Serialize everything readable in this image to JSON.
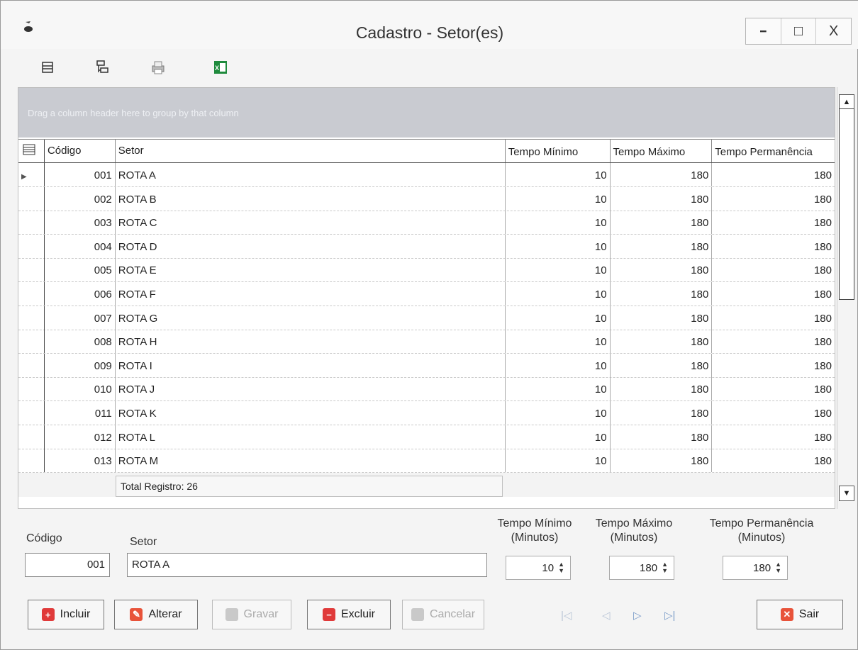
{
  "window": {
    "title": "Cadastro - Setor(es)",
    "controls": {
      "minimize": "━",
      "maximize": "□",
      "close": "X"
    }
  },
  "toolbar": {
    "icons": [
      "grid-view-icon",
      "tree-view-icon",
      "print-icon",
      "excel-export-icon"
    ]
  },
  "grid": {
    "group_panel_text": "Drag a column header here to group by that column",
    "columns": [
      "Código",
      "Setor",
      "Tempo Mínimo",
      "Tempo Máximo",
      "Tempo Permanência"
    ],
    "rows": [
      {
        "codigo": "001",
        "setor": "ROTA A",
        "min": "10",
        "max": "180",
        "perm": "180"
      },
      {
        "codigo": "002",
        "setor": "ROTA B",
        "min": "10",
        "max": "180",
        "perm": "180"
      },
      {
        "codigo": "003",
        "setor": "ROTA C",
        "min": "10",
        "max": "180",
        "perm": "180"
      },
      {
        "codigo": "004",
        "setor": "ROTA D",
        "min": "10",
        "max": "180",
        "perm": "180"
      },
      {
        "codigo": "005",
        "setor": "ROTA E",
        "min": "10",
        "max": "180",
        "perm": "180"
      },
      {
        "codigo": "006",
        "setor": "ROTA F",
        "min": "10",
        "max": "180",
        "perm": "180"
      },
      {
        "codigo": "007",
        "setor": "ROTA G",
        "min": "10",
        "max": "180",
        "perm": "180"
      },
      {
        "codigo": "008",
        "setor": "ROTA H",
        "min": "10",
        "max": "180",
        "perm": "180"
      },
      {
        "codigo": "009",
        "setor": "ROTA I",
        "min": "10",
        "max": "180",
        "perm": "180"
      },
      {
        "codigo": "010",
        "setor": "ROTA J",
        "min": "10",
        "max": "180",
        "perm": "180"
      },
      {
        "codigo": "011",
        "setor": "ROTA K",
        "min": "10",
        "max": "180",
        "perm": "180"
      },
      {
        "codigo": "012",
        "setor": "ROTA L",
        "min": "10",
        "max": "180",
        "perm": "180"
      },
      {
        "codigo": "013",
        "setor": "ROTA M",
        "min": "10",
        "max": "180",
        "perm": "180"
      }
    ],
    "footer_total": "Total Registro: 26"
  },
  "form": {
    "codigo_label": "Código",
    "codigo_value": "001",
    "setor_label": "Setor",
    "setor_value": "ROTA A",
    "tempo_min_label": "Tempo Mínimo",
    "tempo_min_unit": "(Minutos)",
    "tempo_min_value": "10",
    "tempo_max_label": "Tempo Máximo",
    "tempo_max_unit": "(Minutos)",
    "tempo_max_value": "180",
    "tempo_perm_label": "Tempo Permanência",
    "tempo_perm_unit": "(Minutos)",
    "tempo_perm_value": "180"
  },
  "buttons": {
    "incluir": "Incluir",
    "alterar": "Alterar",
    "gravar": "Gravar",
    "excluir": "Excluir",
    "cancelar": "Cancelar",
    "sair": "Sair"
  },
  "navigator": {
    "first": "|◁",
    "prev": "◁",
    "next": "▷",
    "last": "▷|"
  },
  "colors": {
    "group_panel": "#c9cbd1",
    "nav_blue": "#5b8fd6",
    "btn_red": "#e03a3a",
    "excel_green": "#1e8a3c"
  }
}
